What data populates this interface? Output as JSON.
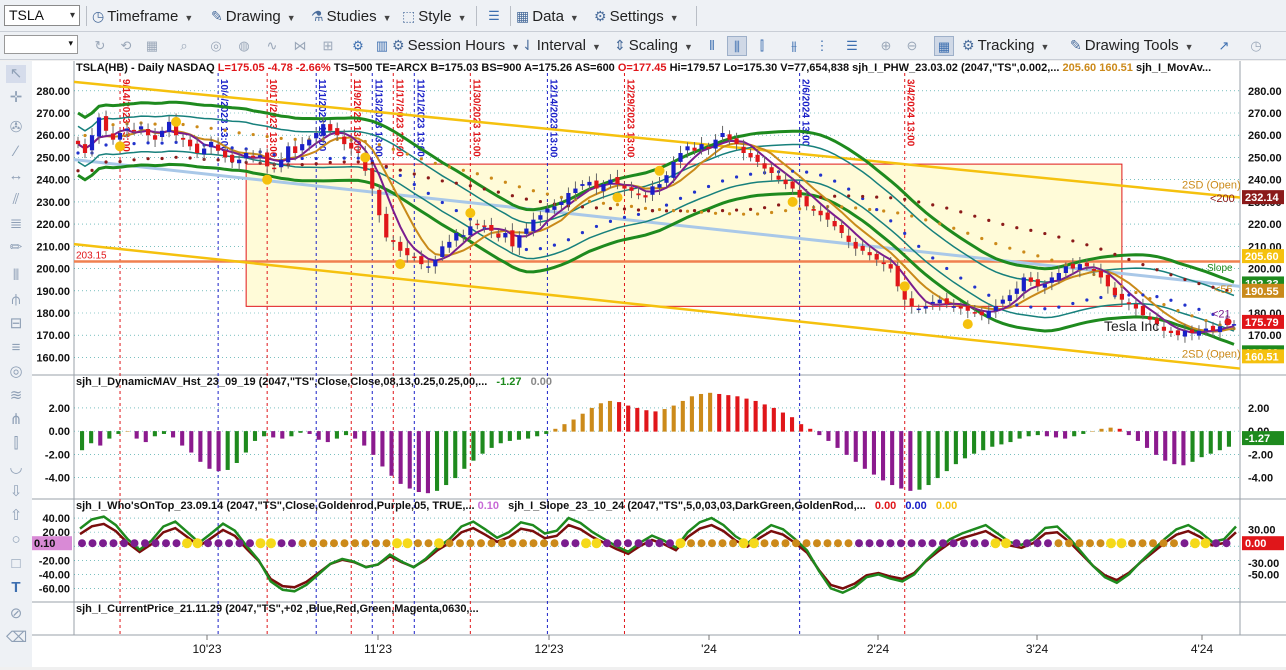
{
  "toolbar": {
    "symbol": "TSLA",
    "menus": [
      {
        "label": "Timeframe",
        "icon": "clock-icon"
      },
      {
        "label": "Drawing",
        "icon": "pencil-icon"
      },
      {
        "label": "Studies",
        "icon": "flask-icon"
      },
      {
        "label": "Style",
        "icon": "style-icon"
      },
      {
        "label": "Data",
        "icon": "grid-icon"
      },
      {
        "label": "Settings",
        "icon": "gear-icon"
      }
    ],
    "row2": [
      {
        "label": "Session Hours",
        "icon": "gear-icon"
      },
      {
        "label": "Interval",
        "icon": "interval-icon"
      },
      {
        "label": "Scaling",
        "icon": "scaling-icon"
      },
      {
        "label": "Tracking",
        "icon": "gear-icon"
      },
      {
        "label": "Drawing Tools",
        "icon": "drawing-tools-icon"
      }
    ]
  },
  "header": {
    "sym": "TSLA(HB) - Daily  NASDAQ",
    "last": "L=175.05",
    "chg": "-4.78",
    "pct": "-2.66%",
    "rest": "TS=500  TE=ARCX  B=175.03  BS=900  A=175.26  AS=600",
    "open": "O=177.45",
    "hilo": "Hi=179.57  Lo=175.30  V=77,654,838",
    "study": "sjh_I_PHW_23.03.02 (2047,\"TS\",0.002,...",
    "v1": "205.60",
    "v2": "160.51",
    "study2": "sjh_I_MovAv..."
  },
  "colors": {
    "up": "#1a20c8",
    "down": "#e0161a",
    "channel": "#f5c10e",
    "bandOuter": "#1e8a1e",
    "bandInner": "#17807c",
    "ema": "#7b1d8e",
    "sma": "#c98a1a",
    "blueDots": "#2233cc",
    "brownDots": "#8b1a1a",
    "orangeDots": "#cc8a1a"
  },
  "chart_data": [
    {
      "type": "candlestick",
      "title": "TSLA(HB) - Daily  NASDAQ",
      "x_labels": [
        "10'23",
        "11'23",
        "12'23",
        "'24",
        "2'24",
        "3'24",
        "4'24"
      ],
      "y_ticks": [
        280,
        270,
        260,
        250,
        240,
        230,
        220,
        210,
        200,
        190,
        180,
        170,
        160
      ],
      "ylim": [
        153,
        288
      ],
      "close": [
        256,
        252,
        260,
        268,
        262,
        258,
        261,
        263,
        262,
        264,
        260,
        258,
        262,
        266,
        260,
        258,
        255,
        252,
        254,
        257,
        253,
        250,
        248,
        249,
        252,
        250,
        251,
        246,
        245,
        249,
        255,
        252,
        256,
        258,
        261,
        265,
        262,
        260,
        256,
        254,
        252,
        244,
        236,
        224,
        214,
        212,
        208,
        206,
        205,
        202,
        201,
        204,
        210,
        212,
        216,
        215,
        219,
        220,
        219,
        217,
        214,
        216,
        210,
        215,
        218,
        222,
        224,
        227,
        228,
        230,
        234,
        236,
        238,
        239,
        236,
        238,
        240,
        238,
        236,
        235,
        233,
        232,
        237,
        238,
        242,
        248,
        252,
        255,
        253,
        256,
        254,
        258,
        261,
        258,
        256,
        252,
        250,
        248,
        245,
        243,
        240,
        238,
        236,
        232,
        228,
        226,
        224,
        222,
        219,
        216,
        212,
        209,
        208,
        206,
        204,
        202,
        200,
        192,
        186,
        183,
        182,
        183,
        185,
        186,
        184,
        183,
        182,
        181,
        180,
        179,
        181,
        183,
        186,
        188,
        191,
        196,
        194,
        192,
        193,
        196,
        198,
        201,
        200,
        202,
        201,
        199,
        196,
        192,
        188,
        186,
        184,
        182,
        179,
        177,
        175,
        172,
        171,
        170,
        172,
        171,
        172,
        173,
        172,
        174,
        176,
        175
      ],
      "channel_lines": [
        {
          "name": "upper",
          "from": [
            "start",
            284
          ],
          "to": [
            "end",
            232
          ]
        },
        {
          "name": "lower",
          "from": [
            "start",
            211
          ],
          "to": [
            "end",
            155
          ]
        },
        {
          "name": "regression",
          "from": [
            "start",
            249
          ],
          "to": [
            "end",
            192
          ]
        }
      ],
      "horizontal_line": {
        "value": 203.15,
        "label": "203.15",
        "color": "#f08050"
      },
      "zone_rect": {
        "y_top": 247,
        "y_bottom": 183
      },
      "dashed_dates": [
        {
          "label": "9/14/2023 13:00",
          "color": "red"
        },
        {
          "label": "10/4/2023 13:00",
          "color": "blue"
        },
        {
          "label": "10/17/2023 13:00",
          "color": "red"
        },
        {
          "label": "11/1/2023 13:00",
          "color": "blue"
        },
        {
          "label": "11/9/2023 13:00",
          "color": "red"
        },
        {
          "label": "11/13/2023 13:00",
          "color": "blue"
        },
        {
          "label": "11/17/2023 13:00",
          "color": "red"
        },
        {
          "label": "11/21/2023 13:00",
          "color": "blue"
        },
        {
          "label": "11/30/2023 13:00",
          "color": "red"
        },
        {
          "label": "12/14/2023 13:00",
          "color": "blue"
        },
        {
          "label": "12/29/2023 13:00",
          "color": "red"
        },
        {
          "label": "2/6/2024 13:00",
          "color": "blue"
        },
        {
          "label": "3/4/2024 13:00",
          "color": "red"
        }
      ],
      "annotations": [
        "2SD (Open)",
        "<200",
        "Slope",
        "<55",
        "<21",
        "Tesla Inc",
        "2SD (Open)"
      ],
      "axis_tags": [
        {
          "text": "232.14",
          "value": 232.14,
          "bg": "#8b1a1a"
        },
        {
          "text": "205.60",
          "value": 205.6,
          "bg": "#f5c10e"
        },
        {
          "text": "192.33",
          "value": 193.3,
          "bg": "#1e8a1e"
        },
        {
          "text": "190.55",
          "value": 190.0,
          "bg": "#c98a1a"
        },
        {
          "text": "175.79",
          "value": 176.0,
          "bg": "#e0161a"
        },
        {
          "text": "163.29",
          "value": 162.3,
          "bg": "#1e8a1e"
        },
        {
          "text": "160.51",
          "value": 160.5,
          "bg": "#f5c10e"
        }
      ]
    },
    {
      "type": "bar",
      "title": "sjh_I_DynamicMAV_Hst_23_09_19 (2047,\"TS\",Close,Close,08,13,0.25,0.25,00,...",
      "last_values": [
        "-1.27",
        "0.00"
      ],
      "y_ticks": [
        2.0,
        0.0,
        -2.0,
        -4.0
      ],
      "ylim": [
        -5.5,
        3.8
      ],
      "values": [
        -1.6,
        -1.0,
        -1.2,
        -0.6,
        -0.2,
        0.0,
        -0.6,
        -0.9,
        -0.4,
        -0.2,
        -0.5,
        -1.2,
        -1.8,
        -2.6,
        -3.2,
        -3.4,
        -3.3,
        -2.7,
        -1.8,
        -0.8,
        -0.4,
        -0.5,
        -0.6,
        -0.4,
        -0.1,
        -0.2,
        -0.7,
        -0.9,
        -0.6,
        -0.3,
        -0.6,
        -1.2,
        -2.0,
        -3.0,
        -3.8,
        -4.5,
        -4.9,
        -5.2,
        -5.3,
        -5.1,
        -4.6,
        -4.0,
        -3.2,
        -2.5,
        -1.9,
        -1.4,
        -1.0,
        -0.8,
        -0.7,
        -0.6,
        -0.4,
        -0.2,
        0.2,
        0.6,
        1.0,
        1.5,
        2.0,
        2.4,
        2.6,
        2.5,
        2.2,
        2.0,
        1.8,
        1.7,
        1.9,
        2.2,
        2.6,
        3.0,
        3.2,
        3.3,
        3.2,
        3.1,
        3.0,
        2.8,
        2.6,
        2.3,
        2.0,
        1.6,
        1.2,
        0.6,
        0.2,
        -0.3,
        -0.8,
        -1.4,
        -2.0,
        -2.6,
        -3.2,
        -3.7,
        -4.2,
        -4.6,
        -4.9,
        -5.1,
        -5.0,
        -4.6,
        -4.0,
        -3.4,
        -2.8,
        -2.3,
        -1.9,
        -1.6,
        -1.3,
        -1.1,
        -0.9,
        -0.6,
        -0.4,
        -0.3,
        -0.4,
        -0.5,
        -0.6,
        -0.4,
        -0.2,
        0.0,
        0.2,
        0.3,
        0.2,
        -0.3,
        -0.8,
        -1.4,
        -2.0,
        -2.5,
        -2.8,
        -2.9,
        -2.6,
        -2.2,
        -1.9,
        -1.6,
        -1.3
      ]
    },
    {
      "type": "line",
      "title": "sjh_I_Who'sOnTop_23.09.14 (2047,\"TS\",Close,Goldenrod,Purple,05,  TRUE,...",
      "title_value": "0.10",
      "title2": "sjh_I_Slope_23_10_24 (2047,\"TS\",5,0,03,03,DarkGreen,GoldenRod,...",
      "title2_values": [
        "0.00",
        "0.00",
        "0.00"
      ],
      "left_value": "0.10",
      "y_ticks_left": [
        40.0,
        20.0,
        0.0,
        -20.0,
        -40.0,
        -60.0
      ],
      "y_ticks_right": [
        30.0,
        0.0,
        -30.0,
        -50.0
      ],
      "ylim": [
        -75,
        50
      ],
      "tag": {
        "text": "0.00",
        "bg": "#e0161a"
      },
      "values": [
        25,
        38,
        42,
        30,
        10,
        -5,
        8,
        28,
        35,
        20,
        5,
        18,
        32,
        22,
        0,
        -20,
        -50,
        -62,
        -64,
        -55,
        -40,
        -25,
        -18,
        -22,
        -30,
        -26,
        -12,
        -22,
        -30,
        -18,
        -2,
        10,
        28,
        35,
        24,
        12,
        20,
        34,
        30,
        18,
        22,
        40,
        33,
        20,
        10,
        0,
        -8,
        5,
        15,
        8,
        -2,
        20,
        34,
        40,
        30,
        14,
        4,
        18,
        30,
        24,
        10,
        -6,
        -35,
        -60,
        -66,
        -58,
        -44,
        -40,
        -46,
        -50,
        -40,
        -20,
        -4,
        10,
        18,
        24,
        30,
        18,
        6,
        2,
        10,
        26,
        28,
        12,
        -8,
        -28,
        -44,
        -52,
        -40,
        -22,
        -6,
        10,
        24,
        30,
        20,
        6,
        10,
        28
      ]
    },
    {
      "type": "line",
      "title": "sjh_I_CurrentPrice_21.11.29 (2047,\"TS\",+02 ,Blue,Red,Green,Magenta,0630,...",
      "values": []
    }
  ]
}
